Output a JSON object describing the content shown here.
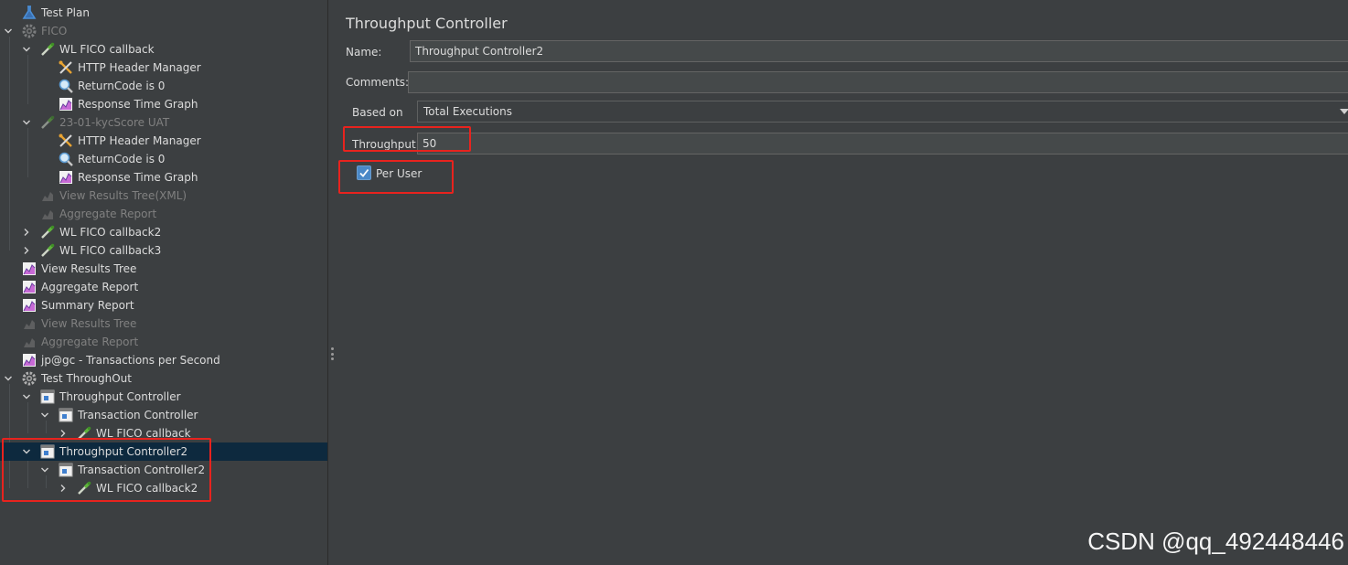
{
  "tree": {
    "items": [
      {
        "label": "Test Plan",
        "icon": "flask-icon",
        "disabled": false
      },
      {
        "label": "FICO",
        "icon": "gear-icon",
        "disabled": true
      },
      {
        "label": "WL FICO callback",
        "icon": "pipette-icon",
        "disabled": false
      },
      {
        "label": "HTTP Header Manager",
        "icon": "tools-icon",
        "disabled": false
      },
      {
        "label": "ReturnCode is 0",
        "icon": "magnifier-icon",
        "disabled": false
      },
      {
        "label": "Response Time Graph",
        "icon": "graph-icon",
        "disabled": false
      },
      {
        "label": "23-01-kycScore UAT",
        "icon": "pipette-icon",
        "disabled": true
      },
      {
        "label": "HTTP Header Manager",
        "icon": "tools-icon",
        "disabled": false
      },
      {
        "label": "ReturnCode is 0",
        "icon": "magnifier-icon",
        "disabled": false
      },
      {
        "label": "Response Time Graph",
        "icon": "graph-icon",
        "disabled": false
      },
      {
        "label": "View Results Tree(XML)",
        "icon": "graph-icon",
        "disabled": true
      },
      {
        "label": "Aggregate Report",
        "icon": "graph-icon",
        "disabled": true
      },
      {
        "label": "WL FICO callback2",
        "icon": "pipette-icon",
        "disabled": false
      },
      {
        "label": "WL FICO callback3",
        "icon": "pipette-icon",
        "disabled": false
      },
      {
        "label": "View Results Tree",
        "icon": "graph-icon",
        "disabled": false
      },
      {
        "label": "Aggregate Report",
        "icon": "graph-icon",
        "disabled": false
      },
      {
        "label": "Summary Report",
        "icon": "graph-icon",
        "disabled": false
      },
      {
        "label": "View Results Tree",
        "icon": "graph-icon",
        "disabled": true
      },
      {
        "label": "Aggregate Report",
        "icon": "graph-icon",
        "disabled": true
      },
      {
        "label": "jp@gc - Transactions per Second",
        "icon": "graph-icon",
        "disabled": false
      },
      {
        "label": "Test ThroughOut",
        "icon": "gear-icon",
        "disabled": false
      },
      {
        "label": "Throughput Controller",
        "icon": "controller-icon",
        "disabled": false
      },
      {
        "label": "Transaction Controller",
        "icon": "controller-icon",
        "disabled": false
      },
      {
        "label": "WL FICO callback",
        "icon": "pipette-icon",
        "disabled": false
      },
      {
        "label": "Throughput Controller2",
        "icon": "controller-icon",
        "disabled": false
      },
      {
        "label": "Transaction Controller2",
        "icon": "controller-icon",
        "disabled": false
      },
      {
        "label": "WL FICO callback2",
        "icon": "pipette-icon",
        "disabled": false
      }
    ]
  },
  "panel": {
    "title": "Throughput Controller",
    "name_label": "Name:",
    "name_value": "Throughput Controller2",
    "comments_label": "Comments:",
    "comments_value": "",
    "based_on_label": "Based on",
    "based_on_value": "Total Executions",
    "throughput_label": "Throughput",
    "throughput_value": "50",
    "per_user_label": "Per User",
    "per_user_checked": true
  },
  "watermark": "CSDN @qq_492448446",
  "colors": {
    "background": "#3c3f41",
    "selection": "#0d293e",
    "highlight_box": "#e8231e",
    "checkbox": "#4a88c7"
  }
}
